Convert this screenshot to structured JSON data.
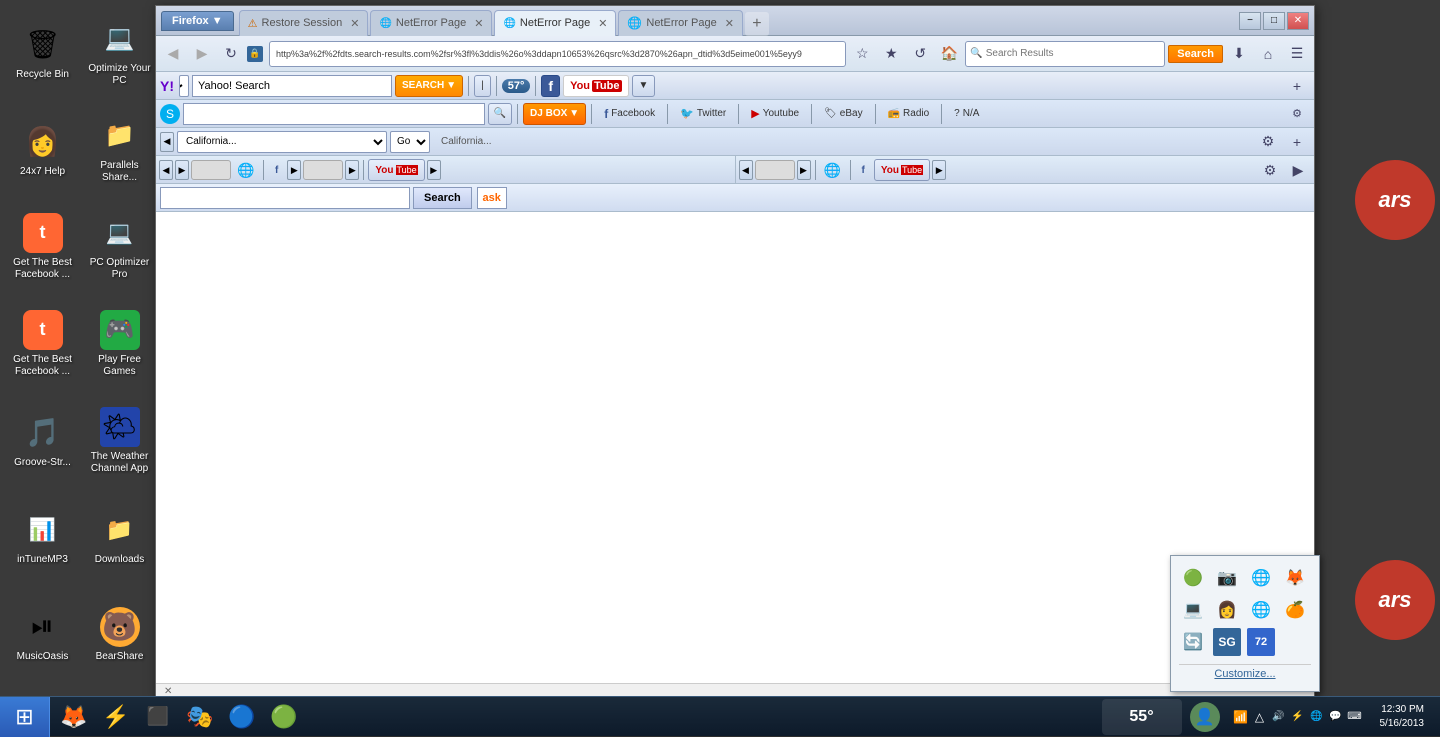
{
  "window": {
    "title": "Firefox",
    "tabs": [
      {
        "label": "Restore Session",
        "active": false,
        "icon": "⚠"
      },
      {
        "label": "NetError Page",
        "active": false,
        "icon": "🌐"
      },
      {
        "label": "NetError Page",
        "active": true,
        "icon": "🌐"
      },
      {
        "label": "NetError Page",
        "active": false,
        "icon": "🌐"
      }
    ],
    "url": "http%3a%2f%2fdts.search-results.com%2fsr%3fl%3ddis%26o%3ddapn10653%26qsrc%3d2870%26apn_dtid%3d5eime001%5eyy9",
    "search_placeholder": "Search Results",
    "controls": {
      "minimize": "−",
      "maximize": "□",
      "close": "✕"
    }
  },
  "toolbars": {
    "yahoo": {
      "search_value": "Yahoo! Search",
      "search_btn": "SEARCH",
      "temp": "57°"
    },
    "skype": {
      "placeholder": ""
    },
    "location_bar": {
      "placeholder": "California..."
    },
    "ask": {
      "search_label": "Search",
      "logo": "ask"
    },
    "bookmarks": [
      {
        "label": "Facebook",
        "icon": "f"
      },
      {
        "label": "Twitter",
        "icon": "t"
      },
      {
        "label": "Youtube",
        "icon": "▶"
      },
      {
        "label": "eBay",
        "icon": "e"
      },
      {
        "label": "Radio",
        "icon": "📻"
      },
      {
        "label": "N/A",
        "icon": "?"
      }
    ],
    "dj_box": {
      "label": "DJ BOX"
    }
  },
  "desktop": {
    "icons": [
      {
        "label": "Recycle Bin",
        "emoji": "🗑",
        "col": 1
      },
      {
        "label": "Optimize Your PC",
        "emoji": "💻",
        "col": 2
      },
      {
        "label": "24x7 Help",
        "emoji": "👩",
        "col": 1
      },
      {
        "label": "Parallels Share...",
        "emoji": "📁",
        "col": 2
      },
      {
        "label": "Get The Best Facebook ...",
        "emoji": "t",
        "col": 1
      },
      {
        "label": "PC Optimizer Pro",
        "emoji": "💻",
        "col": 2
      },
      {
        "label": "Get The Best Facebook ...",
        "emoji": "t",
        "col": 1
      },
      {
        "label": "Play Free Games",
        "emoji": "🎮",
        "col": 2
      },
      {
        "label": "Groove-Str...",
        "emoji": "🎵",
        "col": 1
      },
      {
        "label": "The Weather Channel App",
        "emoji": "🌤",
        "col": 2
      },
      {
        "label": "inTuneMP3",
        "emoji": "📊",
        "col": 1
      },
      {
        "label": "Downloads",
        "emoji": "📁",
        "col": 2
      },
      {
        "label": "MusicOasis",
        "emoji": "⏯",
        "col": 1
      },
      {
        "label": "BearShare",
        "emoji": "🐻",
        "col": 2
      }
    ]
  },
  "tray_popup": {
    "icons": [
      "🟢",
      "📷",
      "🌐",
      "🦊",
      "💻",
      "👩",
      "🌐",
      "🍊",
      "🔄",
      "🎮",
      "72"
    ],
    "customize_label": "Customize..."
  },
  "taskbar": {
    "start_icon": "⊞",
    "apps": [
      "🦊",
      "⚡",
      "⬛",
      "🎭",
      "🔵",
      "🟢"
    ],
    "weather": "55°",
    "clock": {
      "time": "12:30 PM",
      "date": "5/16/2013"
    }
  },
  "ads": {
    "ars": "ars"
  }
}
